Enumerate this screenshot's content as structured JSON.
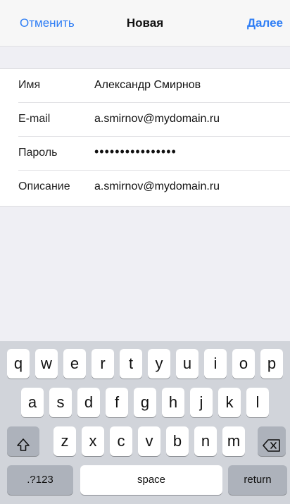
{
  "nav": {
    "cancel_label": "Отменить",
    "title": "Новая",
    "next_label": "Далее"
  },
  "form": {
    "rows": [
      {
        "label": "Имя",
        "value": "Александр Смирнов"
      },
      {
        "label": "E-mail",
        "value": "a.smirnov@mydomain.ru"
      },
      {
        "label": "Пароль",
        "value": "••••••••••••••••"
      },
      {
        "label": "Описание",
        "value": "a.smirnov@mydomain.ru"
      }
    ]
  },
  "keyboard": {
    "row1": [
      "q",
      "w",
      "e",
      "r",
      "t",
      "y",
      "u",
      "i",
      "o",
      "p"
    ],
    "row2": [
      "a",
      "s",
      "d",
      "f",
      "g",
      "h",
      "j",
      "k",
      "l"
    ],
    "row3": [
      "z",
      "x",
      "c",
      "v",
      "b",
      "n",
      "m"
    ],
    "numbers_label": ".?123",
    "space_label": "space",
    "return_label": "return",
    "shift_icon": "shift-icon",
    "backspace_icon": "backspace-icon"
  },
  "colors": {
    "accent": "#2f7ef5",
    "background": "#efeff4",
    "keyboard_bg": "#d1d4da"
  }
}
